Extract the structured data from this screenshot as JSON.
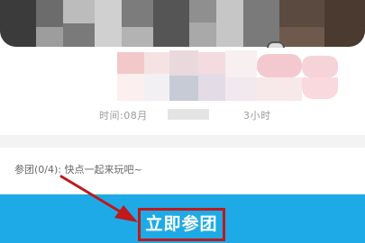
{
  "group_buy": {
    "time_label": "时间:08月",
    "duration_text": "3小时",
    "join_status": "参团(0/4): 快点一起来玩吧~",
    "join_button_label": "立即参团"
  },
  "colors": {
    "primary_button": "#1eaae6",
    "highlight_box": "#c0181b",
    "annotation_arrow": "#c0181b"
  },
  "icons": {
    "annotation_arrow": "red-arrow-icon",
    "card_handle": "card-handle-icon"
  }
}
